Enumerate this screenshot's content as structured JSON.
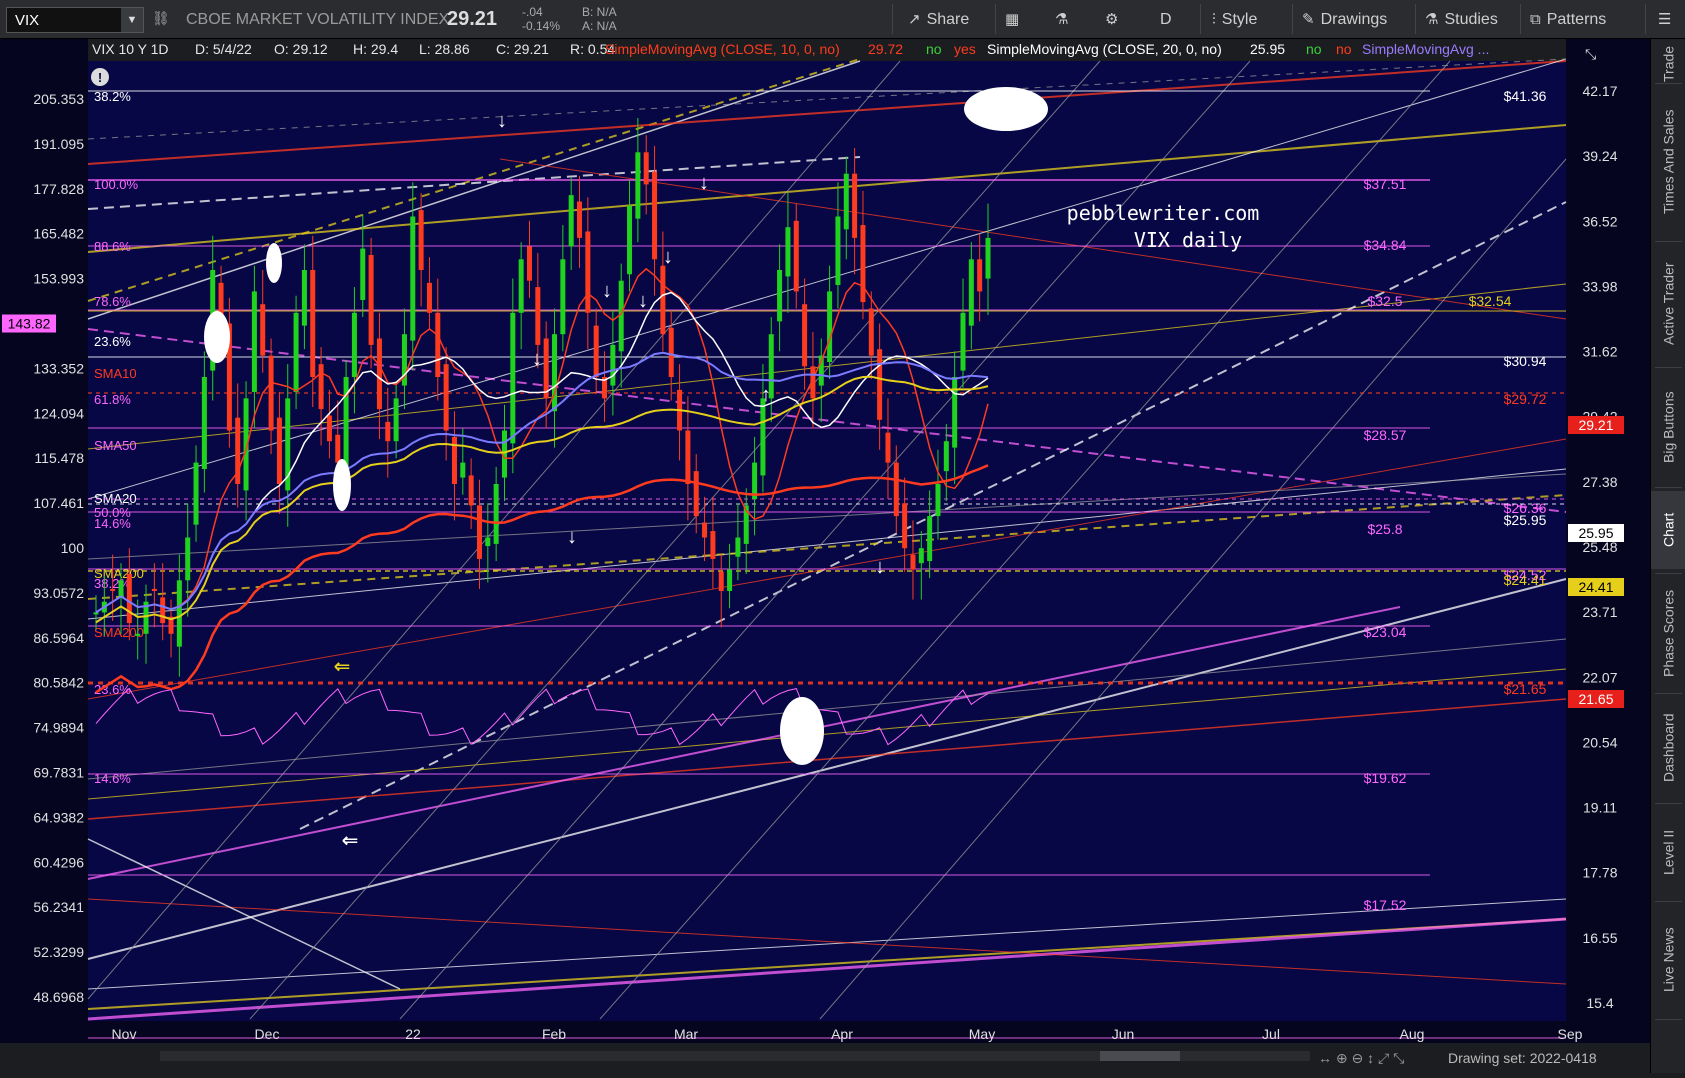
{
  "toolbar": {
    "symbol": "VIX",
    "name": "CBOE MARKET VOLATILITY INDEX",
    "price": "29.21",
    "change": "-.04",
    "change_pct": "-0.14%",
    "bid": "B: N/A",
    "ask": "A: N/A",
    "buttons": {
      "share": "Share",
      "period": "D",
      "style": "Style",
      "drawings": "Drawings",
      "studies": "Studies",
      "patterns": "Patterns"
    }
  },
  "header": {
    "descriptor": "VIX 10 Y 1D",
    "date": "D: 5/4/22",
    "open": "O: 29.12",
    "high": "H: 29.4",
    "low": "L: 28.86",
    "close": "C: 29.21",
    "range": "R: 0.54",
    "sma10_label": "SimpleMovingAvg (CLOSE, 10, 0, no)",
    "sma10_value": "29.72",
    "sma10_no": "no",
    "sma10_yes": "yes",
    "sma20_label": "SimpleMovingAvg (CLOSE, 20, 0, no)",
    "sma20_value": "25.95",
    "sma20_no": "no",
    "sma20_no2": "no",
    "sma_more": "SimpleMovingAvg ..."
  },
  "chart_data": {
    "type": "candlestick",
    "title": "VIX daily",
    "watermark": "pebblewriter.com",
    "x_ticks": [
      "Nov",
      "Dec",
      "22",
      "Feb",
      "Mar",
      "Apr",
      "May",
      "Jun",
      "Jul",
      "Aug",
      "Sep"
    ],
    "left_axis_ticks": [
      "205.353",
      "191.095",
      "177.828",
      "165.482",
      "153.993",
      "143.82",
      "133.352",
      "124.094",
      "115.478",
      "107.461",
      "100",
      "93.0572",
      "86.5964",
      "80.5842",
      "74.9894",
      "69.7831",
      "64.9382",
      "60.4296",
      "56.2341",
      "52.3299",
      "48.6968"
    ],
    "right_axis_ticks": [
      "42.17",
      "39.24",
      "36.52",
      "33.98",
      "31.62",
      "29.42",
      "27.38",
      "25.48",
      "23.71",
      "22.07",
      "20.54",
      "19.11",
      "17.78",
      "16.55",
      "15.4"
    ],
    "right_badges": [
      {
        "value": "29.21",
        "color": "#e8201c"
      },
      {
        "value": "25.95",
        "color": "#ffffff"
      },
      {
        "value": "24.41",
        "color": "#e6cf1a"
      },
      {
        "value": "21.65",
        "color": "#e8201c"
      }
    ],
    "left_badge": {
      "value": "143.82",
      "color": "#ff66ff"
    },
    "fib_levels_left": [
      {
        "label": "38.2%",
        "color": "#ffffff"
      },
      {
        "label": "100.0%",
        "color": "#ff66ff"
      },
      {
        "label": "88.6%",
        "color": "#ff66ff"
      },
      {
        "label": "78.6%",
        "color": "#ff66ff"
      },
      {
        "label": "23.6%",
        "color": "#ffffff"
      },
      {
        "label": "SMA10",
        "color": "#ff3b1f"
      },
      {
        "label": "61.8%",
        "color": "#ff66ff"
      },
      {
        "label": "SMA50",
        "color": "#ff66ff"
      },
      {
        "label": "SMA20",
        "color": "#ffffff"
      },
      {
        "label": "50.0%",
        "color": "#ff66ff"
      },
      {
        "label": "14.6%",
        "color": "#ff66ff"
      },
      {
        "label": "SMA200",
        "color": "#e6cf1a"
      },
      {
        "label": "38.2%",
        "color": "#ff66ff"
      },
      {
        "label": "SMA200",
        "color": "#ff3b1f"
      },
      {
        "label": "23.6%",
        "color": "#ff66ff"
      },
      {
        "label": "14.6%",
        "color": "#ff66ff"
      }
    ],
    "price_levels_right": [
      {
        "label": "$41.36",
        "color": "#ffffff"
      },
      {
        "label": "$37.51",
        "color": "#ff66ff"
      },
      {
        "label": "$34.84",
        "color": "#ff66ff"
      },
      {
        "label": "$32.5",
        "color": "#ff66ff"
      },
      {
        "label": "$32.54",
        "color": "#e6cf1a"
      },
      {
        "label": "$30.94",
        "color": "#ffffff"
      },
      {
        "label": "$29.72",
        "color": "#ff3b1f"
      },
      {
        "label": "$28.57",
        "color": "#ff66ff"
      },
      {
        "label": "$26.36",
        "color": "#ff66ff"
      },
      {
        "label": "$25.95",
        "color": "#ffffff"
      },
      {
        "label": "$25.8",
        "color": "#ff66ff"
      },
      {
        "label": "$24.52",
        "color": "#ff66ff"
      },
      {
        "label": "$24.41",
        "color": "#e6cf1a"
      },
      {
        "label": "$23.04",
        "color": "#ff66ff"
      },
      {
        "label": "$21.65",
        "color": "#ff3b1f"
      },
      {
        "label": "$19.62",
        "color": "#ff66ff"
      },
      {
        "label": "$17.52",
        "color": "#ff66ff"
      }
    ],
    "last_close": 29.21,
    "drawing_set": "Drawing set: 2022-0418"
  },
  "sidebar": {
    "tabs": [
      "Trade",
      "Times And Sales",
      "Active Trader",
      "Big Buttons",
      "Chart",
      "Phase Scores",
      "Dashboard",
      "Level II",
      "Live News"
    ]
  },
  "colors": {
    "background": "#060640",
    "sma10": "#ff3b1f",
    "sma20": "#ffffff",
    "sma50": "#7b7bff",
    "sma200": "#e6cf1a"
  }
}
